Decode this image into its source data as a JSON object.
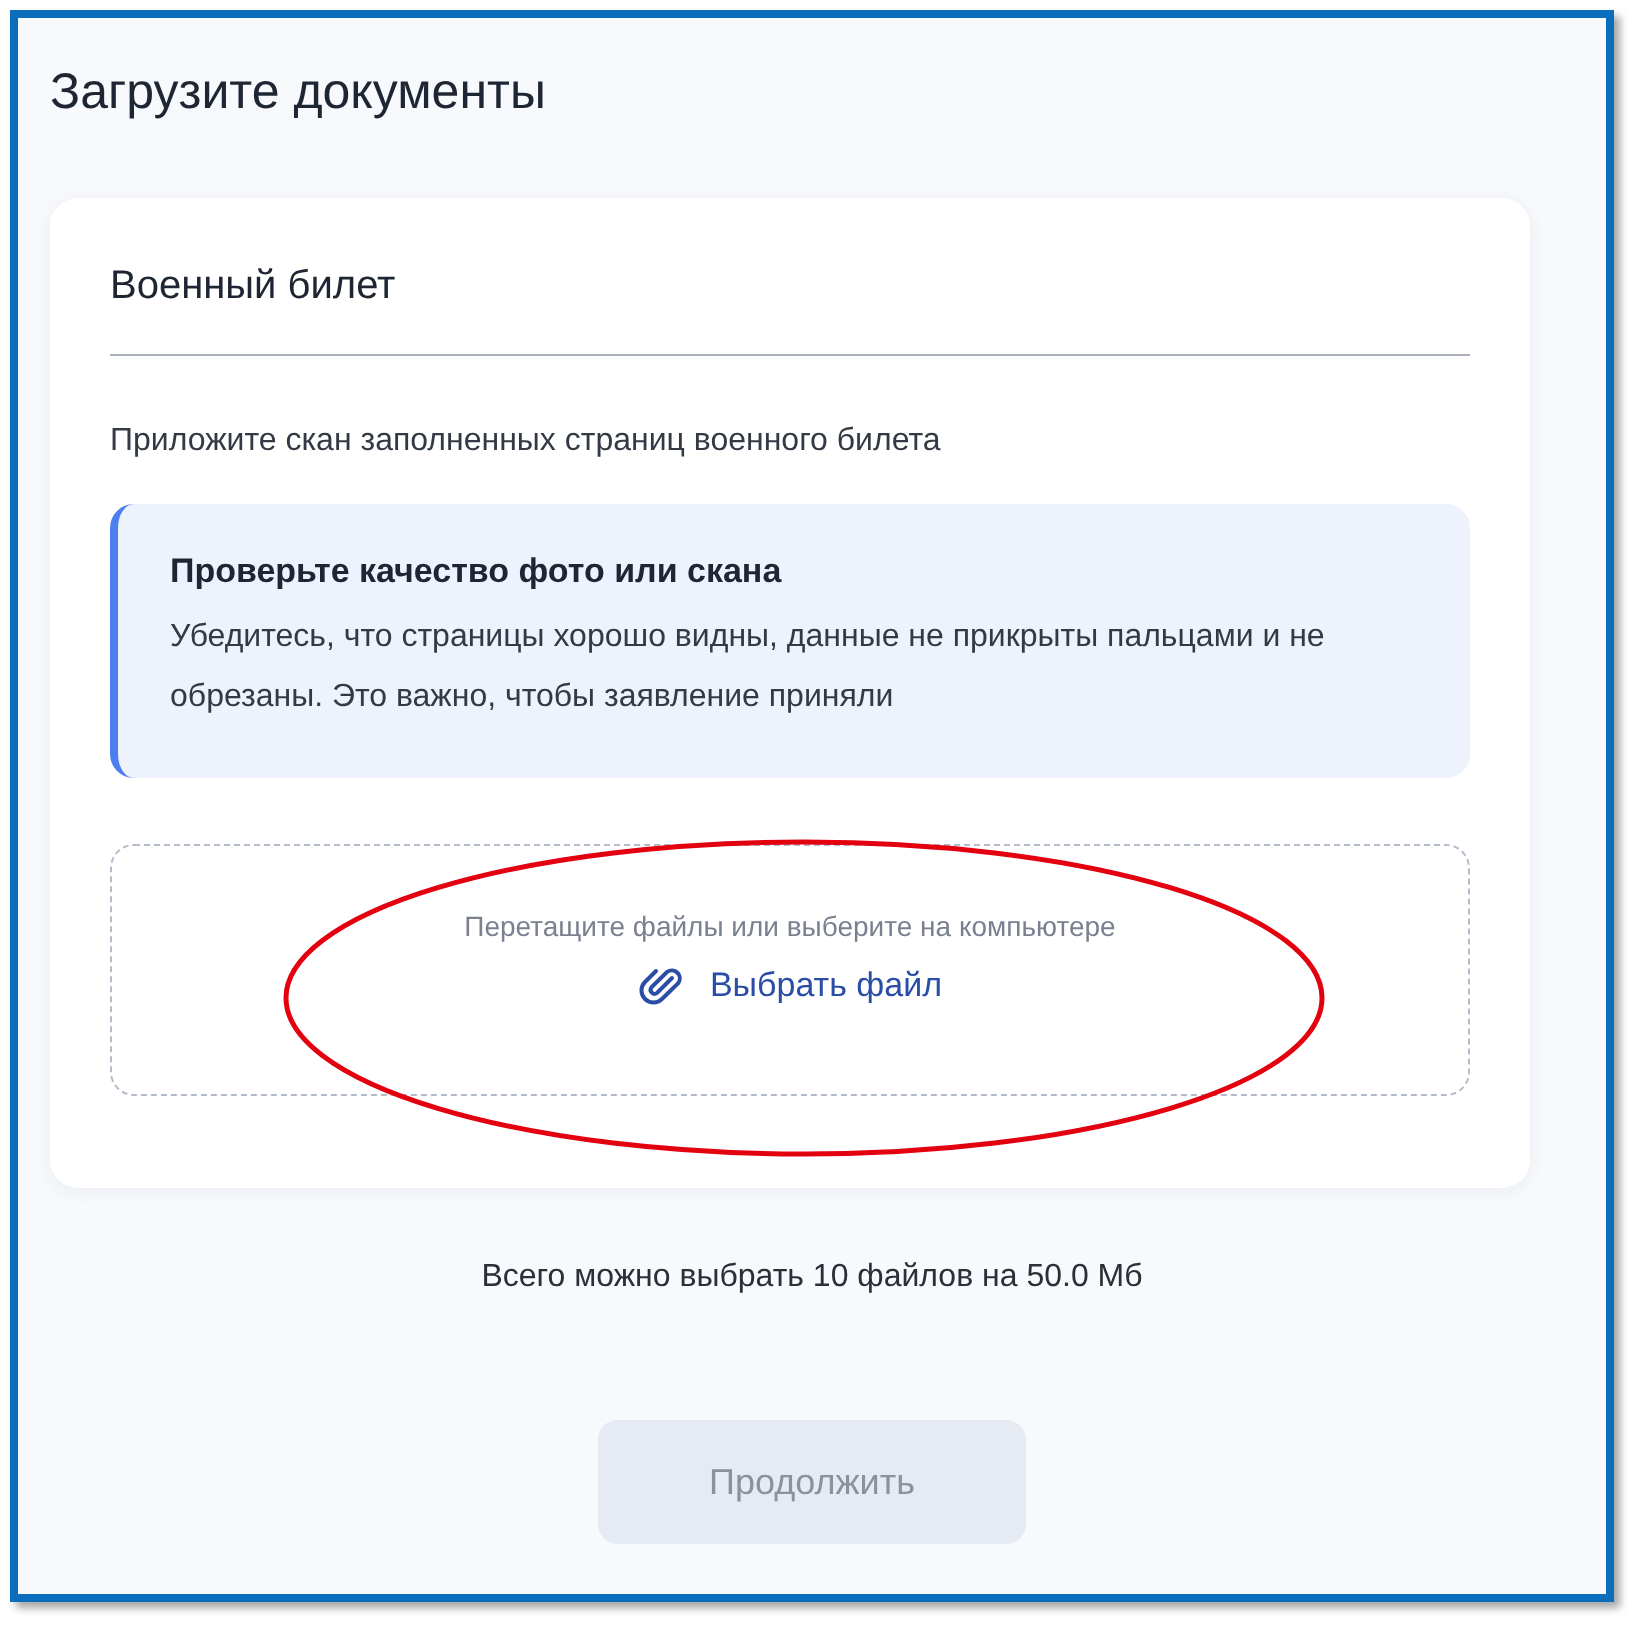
{
  "page_title": "Загрузите документы",
  "card": {
    "title": "Военный билет",
    "description": "Приложите скан заполненных страниц военного билета",
    "notice": {
      "title": "Проверьте качество фото или скана",
      "text": "Убедитесь, что страницы хорошо видны, данные не прикрыты пальцами и не обрезаны. Это важно, чтобы заявление приняли"
    },
    "dropzone": {
      "hint": "Перетащите файлы или выберите на компьютере",
      "link": "Выбрать файл"
    }
  },
  "limit_text": "Всего можно выбрать 10 файлов на 50.0 Мб",
  "continue_button": {
    "label": "Продолжить",
    "disabled": true
  }
}
